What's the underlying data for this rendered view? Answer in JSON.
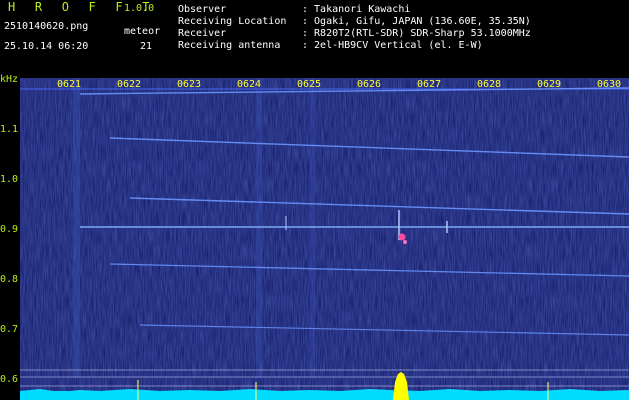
{
  "header": {
    "app_title": "H R O F F T",
    "version": "1.0.0",
    "file_name": "2510140620.png",
    "meteor_label": "meteor",
    "datetime": "25.10.14 06:20",
    "meteor_count": "21",
    "fields": [
      {
        "label": "Observer",
        "value": ": Takanori Kawachi"
      },
      {
        "label": "Receiving Location",
        "value": ": Ogaki, Gifu, JAPAN (136.60E, 35.35N)"
      },
      {
        "label": "Receiver",
        "value": ": R820T2(RTL-SDR) SDR-Sharp 53.1000MHz"
      },
      {
        "label": "Receiving antenna",
        "value": ": 2el-HB9CV Vertical (el. E-W)"
      }
    ]
  },
  "spectrogram": {
    "y_unit": "kHz",
    "y_ticks": [
      "1.1",
      "1.0",
      "0.9",
      "0.8",
      "0.7",
      "0.6"
    ],
    "time_ticks": [
      "0621",
      "0622",
      "0623",
      "0624",
      "0625",
      "0626",
      "0627",
      "0628",
      "0629",
      "0630"
    ],
    "colors": {
      "background": "#101a6a",
      "trace": "#5a8cff",
      "noise_floor": "#00e0ff",
      "peak": "#ffff00"
    }
  }
}
